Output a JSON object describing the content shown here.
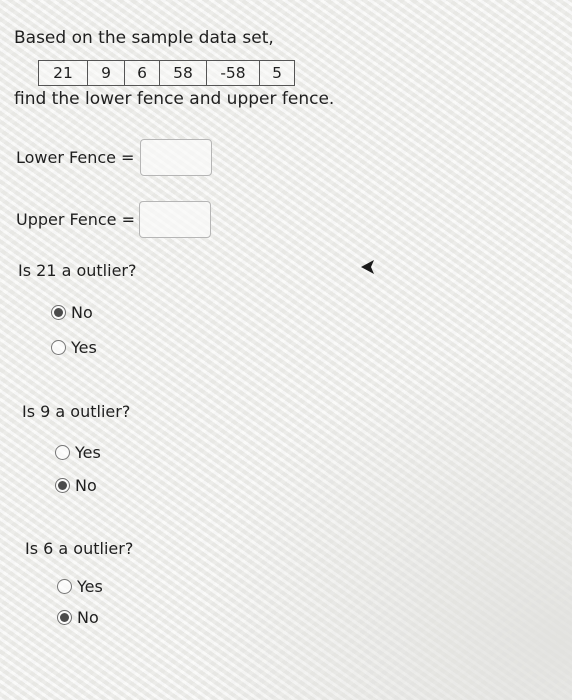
{
  "intro_text": "Based on the sample data set,",
  "dataset": [
    "21",
    "9",
    "6",
    "58",
    "-58",
    "5"
  ],
  "instruction_text": "find the lower fence and upper fence.",
  "lower_fence": {
    "label": "Lower Fence =",
    "value": ""
  },
  "upper_fence": {
    "label": "Upper Fence =",
    "value": ""
  },
  "questions": [
    {
      "text": "Is 21 a outlier?",
      "options": [
        {
          "label": "No",
          "selected": true
        },
        {
          "label": "Yes",
          "selected": false
        }
      ]
    },
    {
      "text": "Is 9 a outlier?",
      "options": [
        {
          "label": "Yes",
          "selected": false
        },
        {
          "label": "No",
          "selected": true
        }
      ]
    },
    {
      "text": "Is 6 a outlier?",
      "options": [
        {
          "label": "Yes",
          "selected": false
        },
        {
          "label": "No",
          "selected": true
        }
      ]
    }
  ],
  "icons": {
    "cursor": "mouse-pointer-icon"
  }
}
